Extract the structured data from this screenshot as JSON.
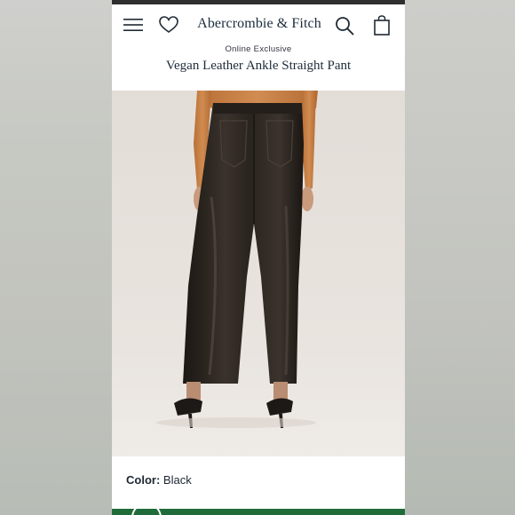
{
  "header": {
    "brand": "Abercrombie & Fitch",
    "icons": [
      "menu-icon",
      "heart-icon",
      "search-icon",
      "bag-icon"
    ]
  },
  "product": {
    "badge": "Online Exclusive",
    "title": "Vegan Leather Ankle Straight Pant",
    "color_label": "Color:",
    "color_value": "Black"
  },
  "colors": {
    "text_dark": "#1d2b39",
    "photo_bg": "#e7e1dc",
    "pant_leather": "#2a2520",
    "top_knit": "#c9834a",
    "footer_green": "#1f6b3a"
  }
}
